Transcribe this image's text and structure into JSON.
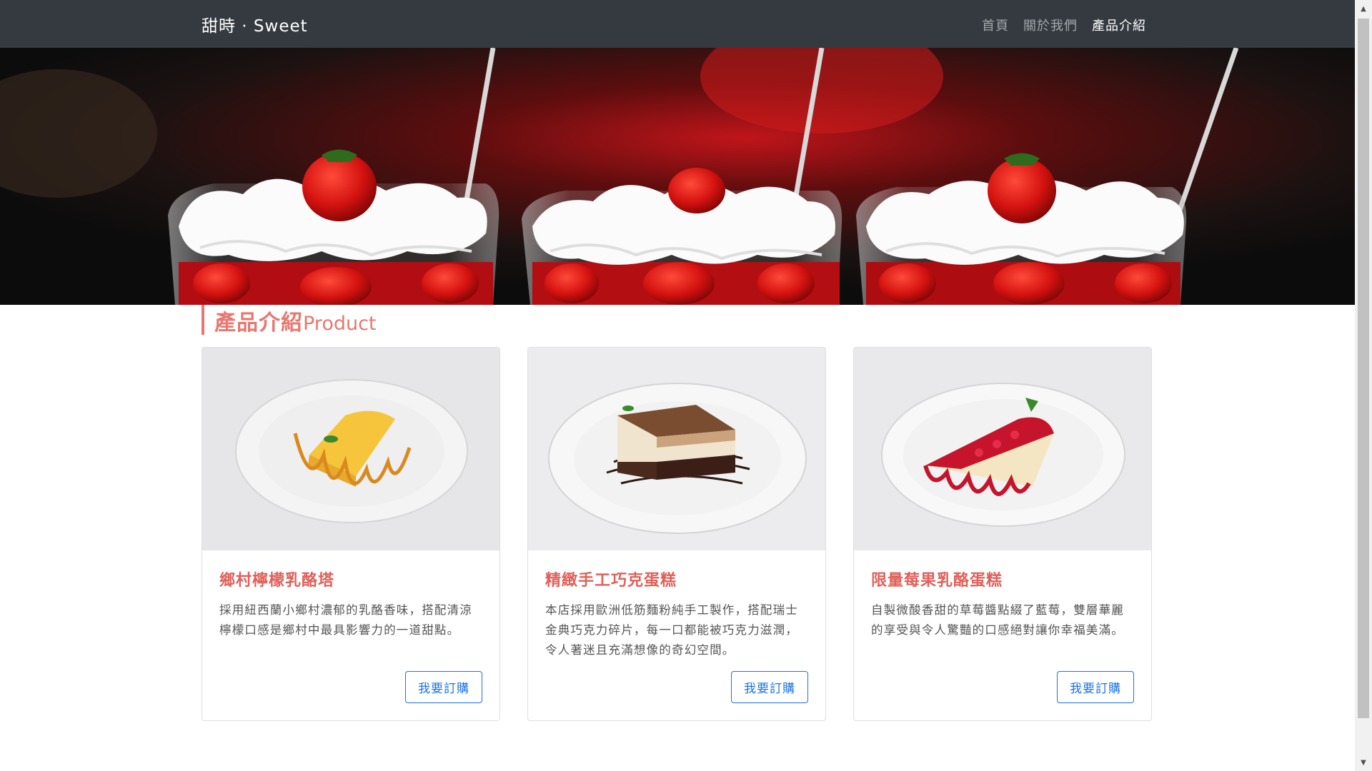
{
  "nav": {
    "brand": "甜時 · Sweet",
    "links": [
      {
        "label": "首頁",
        "active": false
      },
      {
        "label": "關於我們",
        "active": false
      },
      {
        "label": "產品介紹",
        "active": true
      }
    ]
  },
  "hero": {
    "image": "strawberry-parfait-image"
  },
  "section": {
    "title_zh": "產品介紹",
    "title_en": "Product"
  },
  "products": [
    {
      "image": "lemon-cheesecake-image",
      "title": "鄉村檸檬乳酪塔",
      "text": "採用紐西蘭小鄉村濃郁的乳酪香味，搭配清涼檸檬口感是鄉村中最具影響力的一道甜點。",
      "button": "我要訂購"
    },
    {
      "image": "chocolate-cake-image",
      "title": "精緻手工巧克蛋糕",
      "text": "本店採用歐洲低筋麵粉純手工製作，搭配瑞士金典巧克力碎片，每一口都能被巧克力滋潤，令人著迷且充滿想像的奇幻空間。",
      "button": "我要訂購"
    },
    {
      "image": "berry-cheesecake-image",
      "title": "限量莓果乳酪蛋糕",
      "text": "自製微酸香甜的草莓醬點綴了藍莓，雙層華麗的享受與令人驚豔的口感絕對讓你幸福美滿。",
      "button": "我要訂購"
    }
  ],
  "colors": {
    "navbar_bg": "#343a40",
    "accent": "#e8776f",
    "card_title": "#e0605a",
    "button": "#1a73e8"
  }
}
